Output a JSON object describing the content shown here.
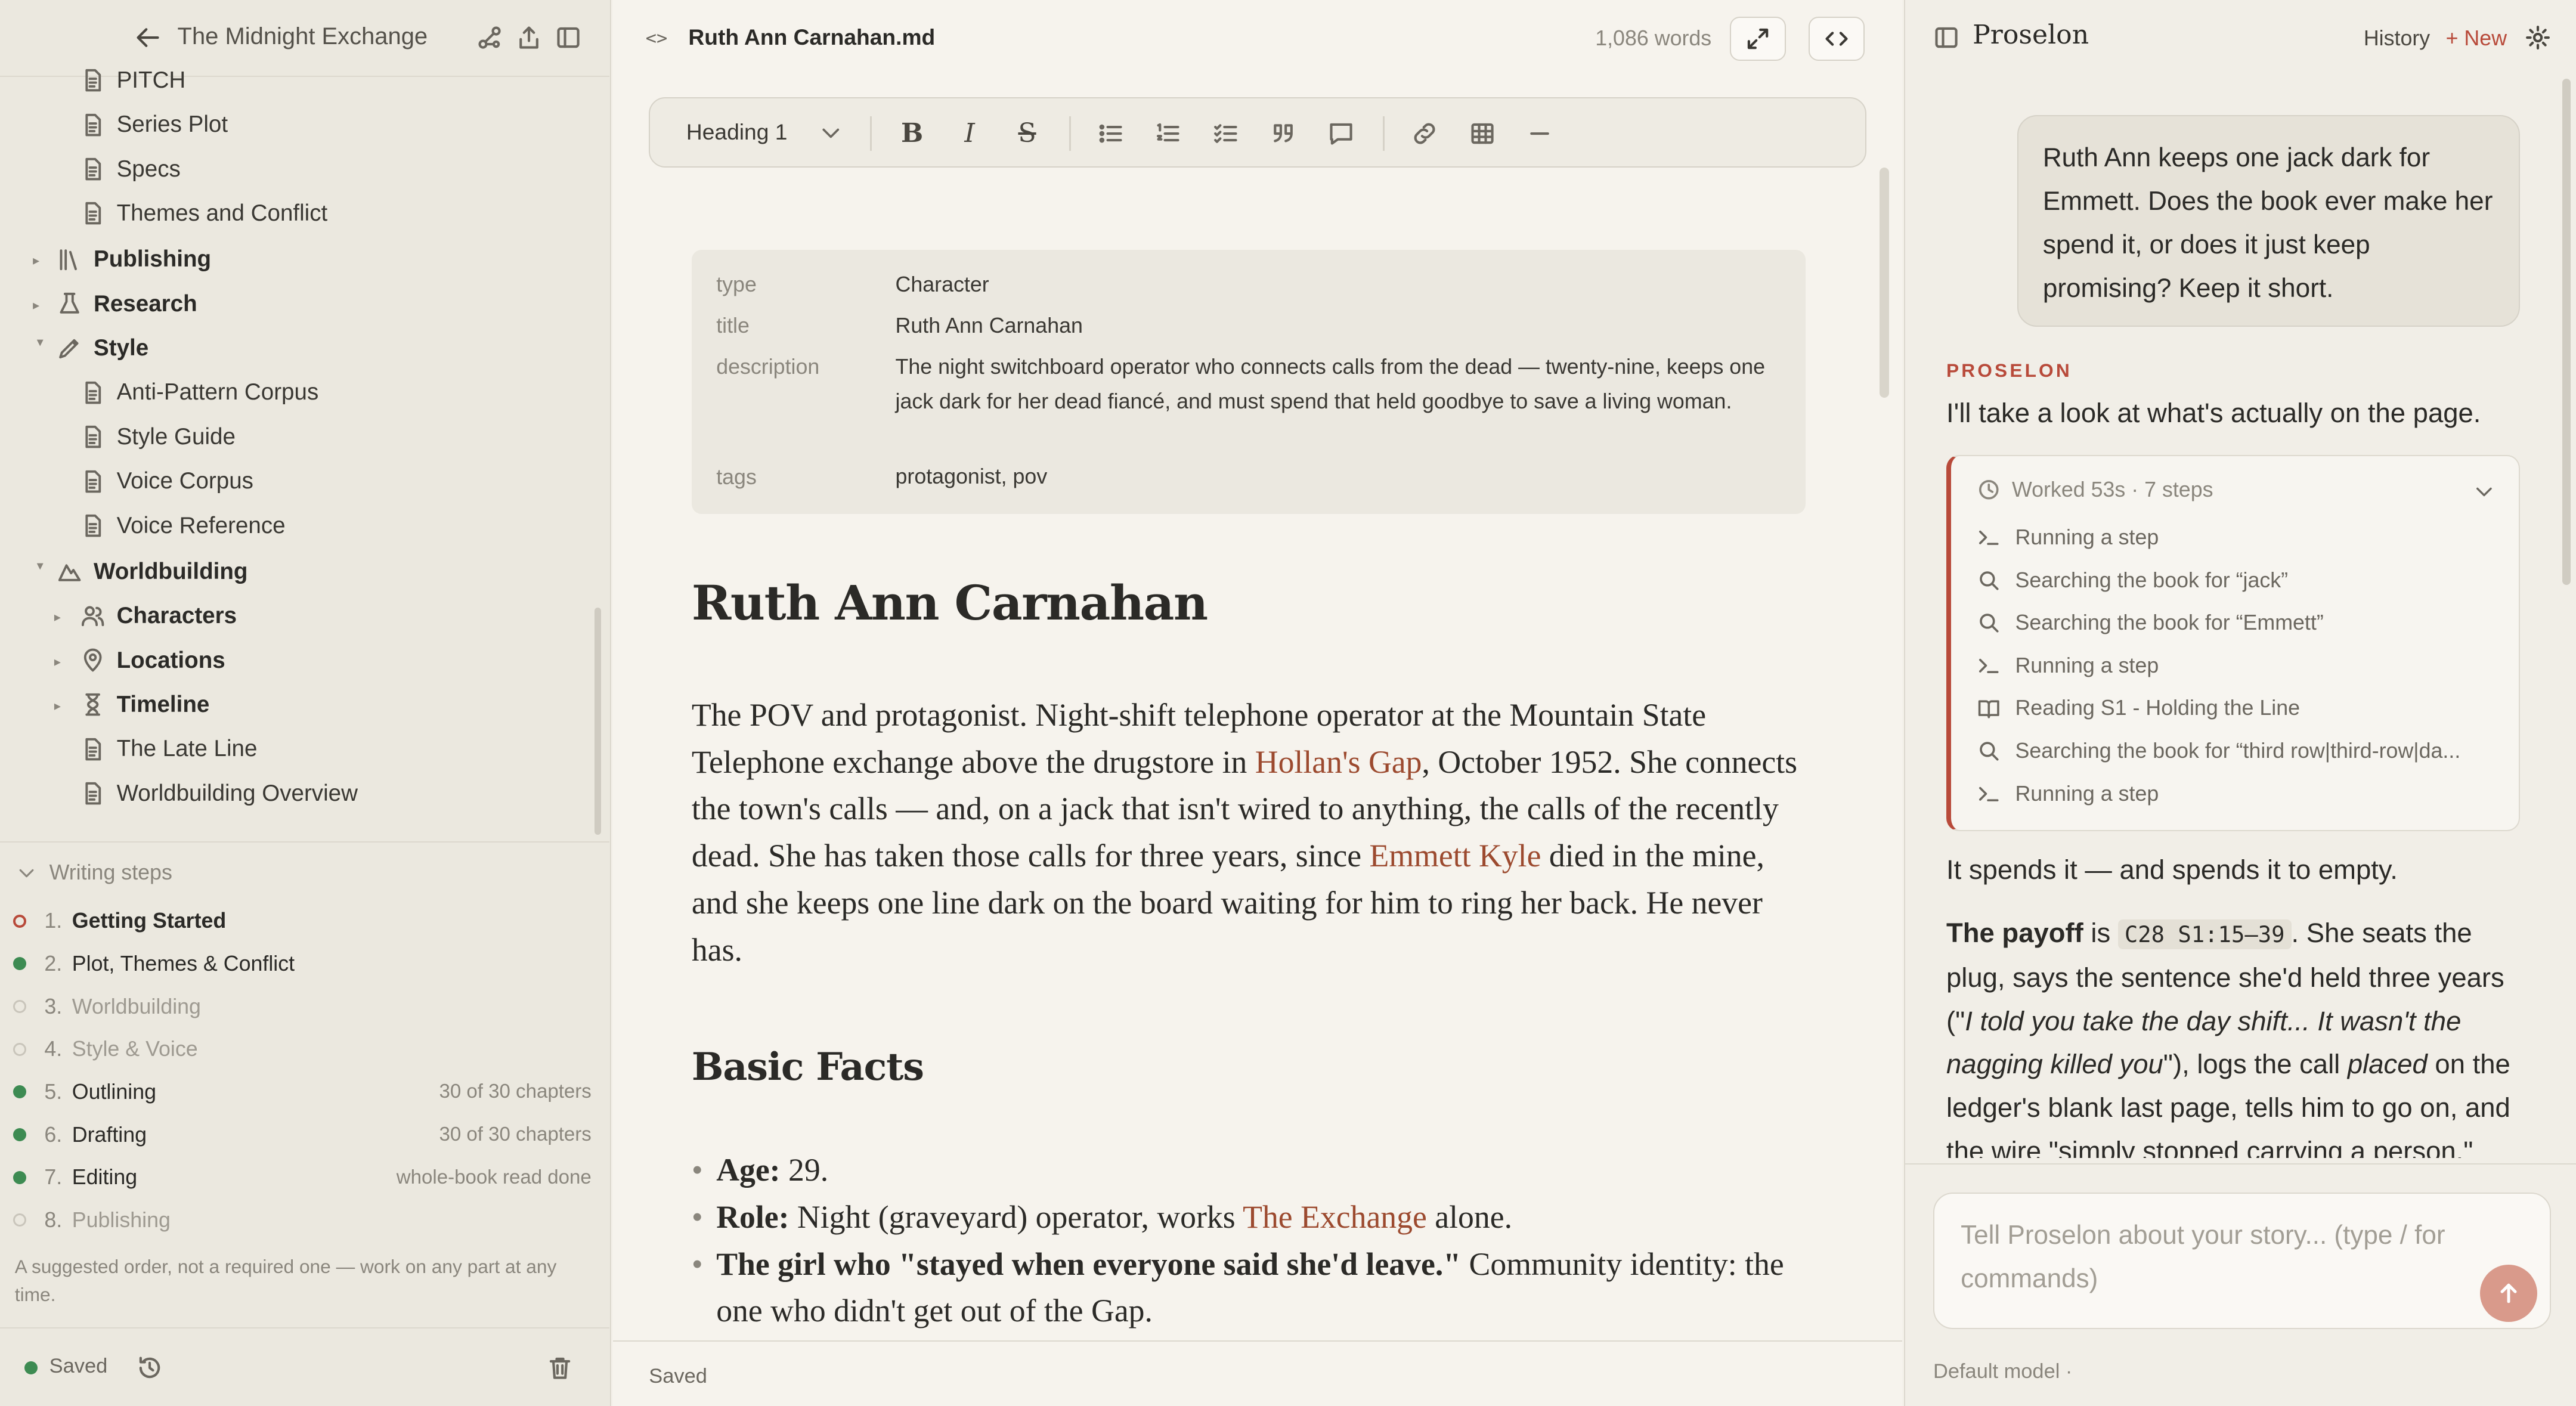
{
  "sidebar": {
    "project_title": "The Midnight Exchange",
    "tree": [
      {
        "label": "PITCH",
        "kind": "file"
      },
      {
        "label": "Series Plot",
        "kind": "file"
      },
      {
        "label": "Specs",
        "kind": "file"
      },
      {
        "label": "Themes and Conflict",
        "kind": "file"
      },
      {
        "label": "Publishing",
        "kind": "folder",
        "icon": "books-icon"
      },
      {
        "label": "Research",
        "kind": "folder",
        "icon": "flask-icon"
      },
      {
        "label": "Style",
        "kind": "folder",
        "icon": "pen-icon"
      },
      {
        "label": "Anti-Pattern Corpus",
        "kind": "file"
      },
      {
        "label": "Style Guide",
        "kind": "file"
      },
      {
        "label": "Voice Corpus",
        "kind": "file"
      },
      {
        "label": "Voice Reference",
        "kind": "file"
      },
      {
        "label": "Worldbuilding",
        "kind": "folder",
        "icon": "mountain-icon"
      },
      {
        "label": "Characters",
        "kind": "folder",
        "icon": "people-icon"
      },
      {
        "label": "Locations",
        "kind": "folder",
        "icon": "pin-icon"
      },
      {
        "label": "Timeline",
        "kind": "folder",
        "icon": "hourglass-icon"
      },
      {
        "label": "The Late Line",
        "kind": "file"
      },
      {
        "label": "Worldbuilding Overview",
        "kind": "file"
      }
    ],
    "steps_heading": "Writing steps",
    "steps": [
      {
        "num": "1.",
        "label": "Getting Started",
        "meta": "",
        "status": "current"
      },
      {
        "num": "2.",
        "label": "Plot, Themes & Conflict",
        "meta": "",
        "status": "done"
      },
      {
        "num": "3.",
        "label": "Worldbuilding",
        "meta": "",
        "status": "todo"
      },
      {
        "num": "4.",
        "label": "Style & Voice",
        "meta": "",
        "status": "todo"
      },
      {
        "num": "5.",
        "label": "Outlining",
        "meta": "30 of 30 chapters",
        "status": "done"
      },
      {
        "num": "6.",
        "label": "Drafting",
        "meta": "30 of 30 chapters",
        "status": "done"
      },
      {
        "num": "7.",
        "label": "Editing",
        "meta": "whole-book read done",
        "status": "done"
      },
      {
        "num": "8.",
        "label": "Publishing",
        "meta": "",
        "status": "todo"
      }
    ],
    "steps_note": "A suggested order, not a required one — work on any part at any time.",
    "saved_label": "Saved"
  },
  "editor": {
    "filename": "Ruth Ann Carnahan.md",
    "word_count": "1,086 words",
    "toolbar": {
      "heading_select": "Heading 1",
      "bold": "B",
      "italic": "I",
      "strike": "S"
    },
    "frontmatter": {
      "type_key": "type",
      "type_val": "Character",
      "title_key": "title",
      "title_val": "Ruth Ann Carnahan",
      "desc_key": "description",
      "desc_val": "The night switchboard operator who connects calls from the dead — twenty-nine, keeps one jack dark for her dead fiancé, and must spend that held goodbye to save a living woman.",
      "tags_key": "tags",
      "tags_val": "protagonist, pov"
    },
    "doc_title": "Ruth Ann Carnahan",
    "para": {
      "p1": "The POV and protagonist. Night-shift telephone operator at the Mountain State Telephone exchange above the drugstore in ",
      "link1": "Hollan's Gap",
      "p2": ", October 1952. She connects the town's calls — and, on a jack that isn't wired to anything, the calls of the recently dead. She has taken those calls for three years, since ",
      "link2": "Emmett Kyle",
      "p3": " died in the mine, and she keeps one line dark on the board waiting for him to ring her back. He never has."
    },
    "h2": "Basic Facts",
    "facts": {
      "age_label": "Age:",
      "age_val": " 29.",
      "role_label": "Role:",
      "role_pre": " Night (graveyard) operator, works ",
      "role_link": "The Exchange",
      "role_post": " alone.",
      "girl_label": "The girl who \"stayed when everyone said she'd leave.\"",
      "girl_val": " Community identity: the one who didn't get out of the Gap."
    },
    "status": "Saved"
  },
  "assistant": {
    "title": "Proselon",
    "history": "History",
    "new": "+ New",
    "user_message": "Ruth Ann keeps one jack dark for Emmett. Does the book ever make her spend it, or does it just keep promising? Keep it short.",
    "label": "PROSELON",
    "reply_intro": "I'll take a look at what's actually on the page.",
    "worked": "Worked 53s · 7 steps",
    "work_steps": [
      {
        "icon": "terminal-icon",
        "text": "Running a step"
      },
      {
        "icon": "search-icon",
        "text": "Searching the book for “jack”"
      },
      {
        "icon": "search-icon",
        "text": "Searching the book for “Emmett”"
      },
      {
        "icon": "terminal-icon",
        "text": "Running a step"
      },
      {
        "icon": "book-icon",
        "text": "Reading S1 - Holding the Line"
      },
      {
        "icon": "search-icon",
        "text": "Searching the book for “third row|third-row|da..."
      },
      {
        "icon": "terminal-icon",
        "text": "Running a step"
      }
    ],
    "answer1": "It spends it — and spends it to empty.",
    "answer2": {
      "bold": "The payoff",
      "is": " is ",
      "code": "C28 S1:15–39",
      "t1": ". She seats the plug, says the sentence she'd held three years (\"",
      "em1": "I told you take the day shift... It wasn't the nagging killed you",
      "t2": "\"), logs the call ",
      "em2": "placed",
      "t3": " on the ledger's blank last page, tells him to go on, and the wire \"simply stopped carrying a person.\""
    },
    "composer_placeholder": "Tell Proselon about your story...  (type / for commands)",
    "model": "Default model ·"
  }
}
